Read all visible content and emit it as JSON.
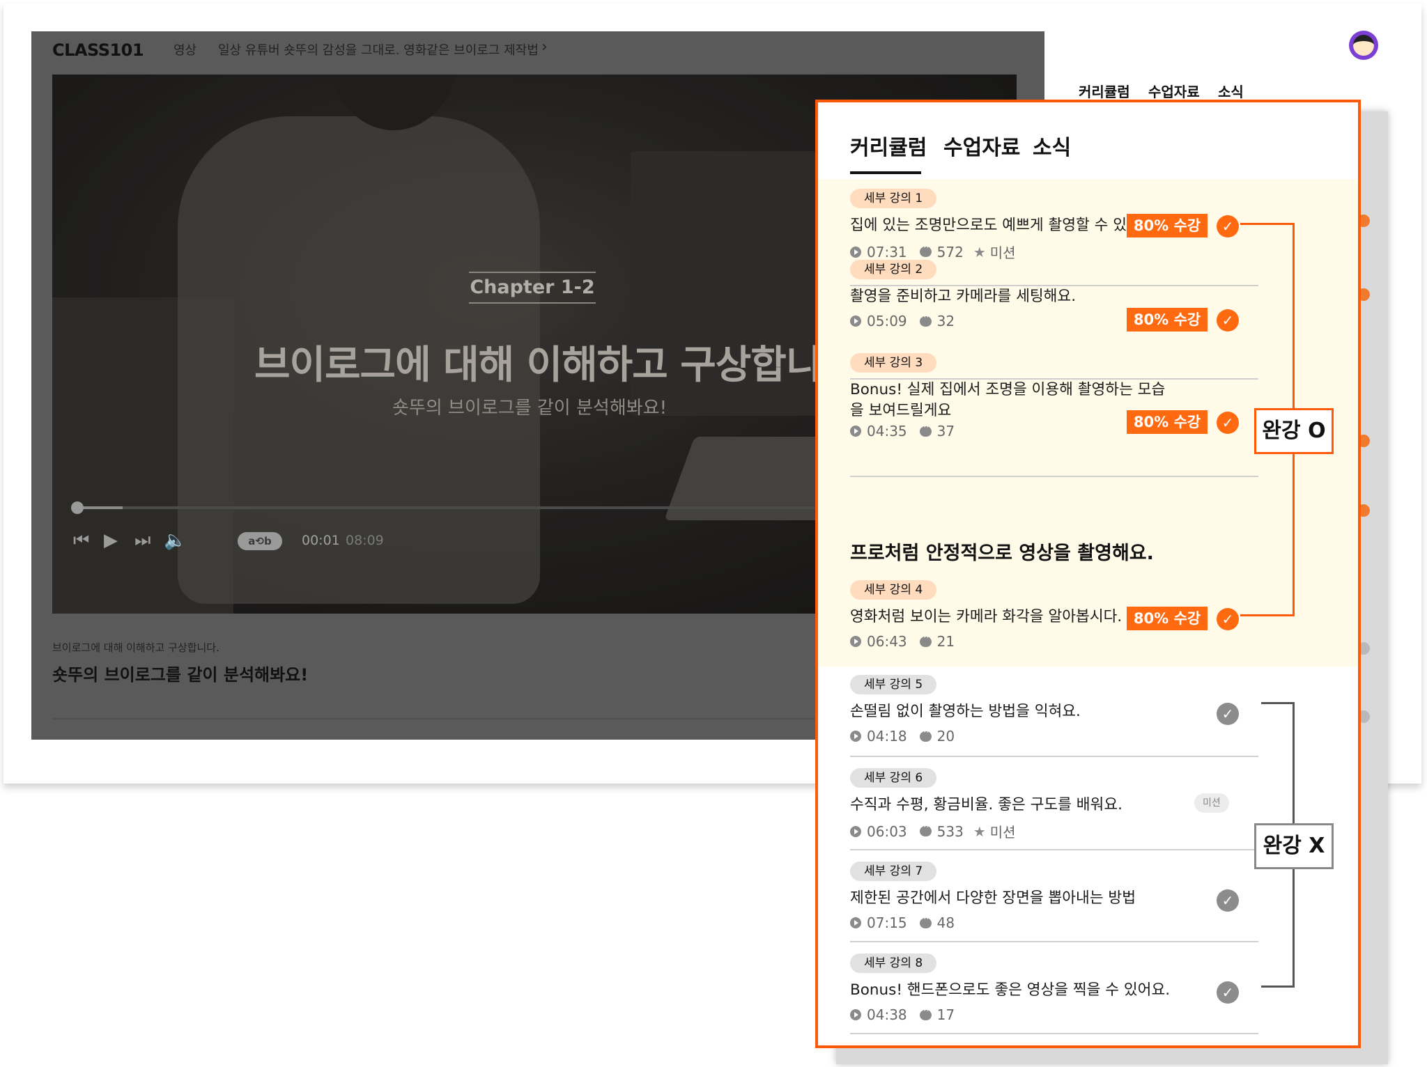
{
  "background_page": {
    "brand": "CLASS101",
    "breadcrumb": [
      "영상",
      "일상 유튜버 숏뚜의 감성을 그대로. 영화같은 브이로그 제작법"
    ],
    "breadcrumb_chevron": "›",
    "video": {
      "chapter": "Chapter 1-2",
      "title": "브이로그에 대해 이해하고 구상합니다",
      "subtitle": "숏뚜의 브이로그를 같이 분석해봐요!",
      "progress": 0.05,
      "time_current": "00:01",
      "time_total": "08:09",
      "ab_label": "a⟲b",
      "controls": [
        "skip-back-icon",
        "play-icon",
        "skip-forward-icon",
        "volume-icon"
      ]
    },
    "description": {
      "small": "브이로그에 대해 이해하고 구상합니다.",
      "big": "숏뚜의 브이로그를 같이 분석해봐요!"
    },
    "tabs": [
      "커리큘럼",
      "수업자료",
      "소식"
    ]
  },
  "panel": {
    "tabs": [
      "커리큘럼",
      "수업자료",
      "소식"
    ],
    "active_tab": "커리큘럼",
    "section_title": "프로처럼 안정적으로 영상을 촬영해요.",
    "items": [
      {
        "badge": "세부 강의 1",
        "title": "집에 있는 조명만으로도 예쁘게 촬영할 수 있어요",
        "duration": "07:31",
        "comments": "572",
        "mission": "미션",
        "progress_tag": "80% 수강",
        "completed": true
      },
      {
        "badge": "세부 강의 2",
        "title": "촬영을 준비하고 카메라를 세팅해요.",
        "duration": "05:09",
        "comments": "32",
        "progress_tag": "80% 수강",
        "completed": true
      },
      {
        "badge": "세부 강의 3",
        "title": "Bonus! 실제 집에서 조명을 이용해 촬영하는 모습을 보여드릴게요",
        "duration": "04:35",
        "comments": "37",
        "progress_tag": "80% 수강",
        "completed": true
      },
      {
        "badge": "세부 강의 4",
        "title": "영화처럼 보이는 카메라 화각을 알아봅시다.",
        "duration": "06:43",
        "comments": "21",
        "progress_tag": "80% 수강",
        "completed": true
      },
      {
        "badge": "세부 강의 5",
        "title": "손떨림 없이 촬영하는 방법을 익혀요.",
        "duration": "04:18",
        "comments": "20",
        "completed": false
      },
      {
        "badge": "세부 강의 6",
        "title": "수직과 수평, 황금비율. 좋은 구도를 배워요.",
        "duration": "06:03",
        "comments": "533",
        "mission": "미션",
        "mission_pill": "미션",
        "completed": false
      },
      {
        "badge": "세부 강의 7",
        "title": "제한된 공간에서 다양한 장면을 뽑아내는 방법",
        "duration": "07:15",
        "comments": "48",
        "completed": false
      },
      {
        "badge": "세부 강의 8",
        "title": "Bonus! 핸드폰으로도 좋은 영상을 찍을 수 있어요.",
        "duration": "04:38",
        "comments": "17",
        "completed": false
      }
    ]
  },
  "annotations": {
    "completed_label": "완강 O",
    "not_completed_label": "완강 X"
  },
  "colors": {
    "accent": "#ff5a0a",
    "progress_tag": "#ff6a10",
    "completed_bg": "#fffbe8",
    "badge_done": "#ffdcbd",
    "badge_pending": "#e1e1e1",
    "check_pending": "#8c8c8c"
  }
}
